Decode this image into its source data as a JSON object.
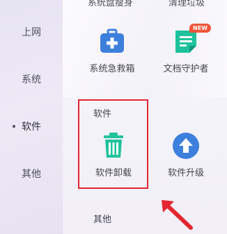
{
  "sidebar": {
    "items": [
      {
        "label": "上网"
      },
      {
        "label": "系统"
      },
      {
        "label": "软件",
        "active": true
      },
      {
        "label": "其他"
      }
    ]
  },
  "top_row": {
    "left_cut": "系统盘瘦身",
    "right_cut": "清理垃圾"
  },
  "tools": [
    {
      "label": "系统急救箱",
      "icon": "first-aid-kit-icon"
    },
    {
      "label": "文档守护者",
      "icon": "document-icon",
      "badge": "NEW"
    }
  ],
  "software_section": {
    "title": "软件",
    "items": [
      {
        "label": "软件卸载",
        "icon": "trash-icon"
      },
      {
        "label": "软件升级",
        "icon": "upgrade-icon"
      }
    ]
  },
  "other_section": {
    "title": "其他"
  },
  "colors": {
    "highlight": "#e3262f",
    "blue": "#3d7fdc",
    "green": "#1fc29c",
    "badge": "#f0553a"
  }
}
